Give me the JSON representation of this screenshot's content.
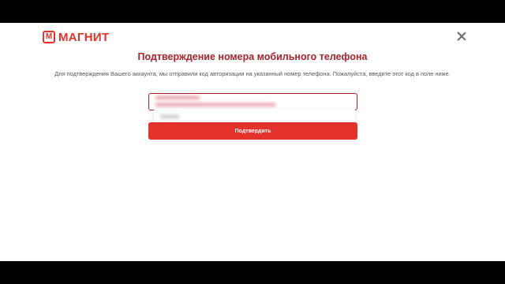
{
  "brand": {
    "logo_mark": "М",
    "name": "МАГНИТ",
    "color": "#e4312b"
  },
  "close_icon": "close-icon",
  "heading": "Подтверждение номера мобильного телефона",
  "description": "Для подтверждения Вашего аккаунта, мы отправили код авторизации на указанный номер телефона. Пожалуйста, введите этот код в поле ниже.",
  "confirm_button": "Подтвердить",
  "colors": {
    "title": "#a8232a",
    "button": "#e4312b",
    "input_border": "#b21f2a"
  }
}
